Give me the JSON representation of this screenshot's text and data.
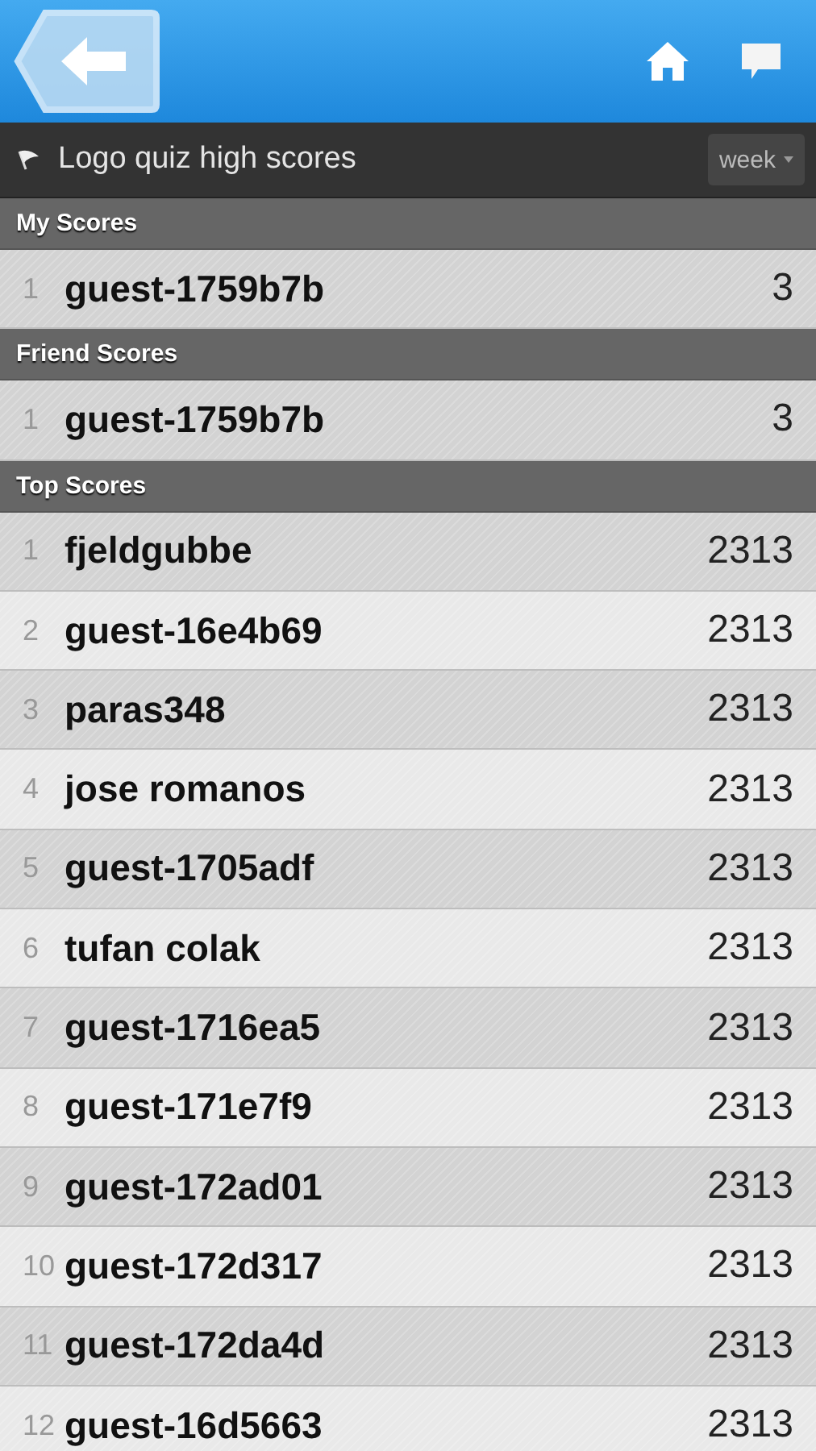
{
  "title_bar": {
    "title": "Logo quiz high scores",
    "period": "week"
  },
  "sections": [
    {
      "heading": "My Scores",
      "rows": [
        {
          "rank": "1",
          "name": "guest-1759b7b",
          "score": "3"
        }
      ]
    },
    {
      "heading": "Friend Scores",
      "rows": [
        {
          "rank": "1",
          "name": "guest-1759b7b",
          "score": "3"
        }
      ]
    },
    {
      "heading": "Top Scores",
      "rows": [
        {
          "rank": "1",
          "name": "fjeldgubbe",
          "score": "2313"
        },
        {
          "rank": "2",
          "name": "guest-16e4b69",
          "score": "2313"
        },
        {
          "rank": "3",
          "name": "paras348",
          "score": "2313"
        },
        {
          "rank": "4",
          "name": "jose romanos",
          "score": "2313"
        },
        {
          "rank": "5",
          "name": "guest-1705adf",
          "score": "2313"
        },
        {
          "rank": "6",
          "name": "tufan colak",
          "score": "2313"
        },
        {
          "rank": "7",
          "name": "guest-1716ea5",
          "score": "2313"
        },
        {
          "rank": "8",
          "name": "guest-171e7f9",
          "score": "2313"
        },
        {
          "rank": "9",
          "name": "guest-172ad01",
          "score": "2313"
        },
        {
          "rank": "10",
          "name": "guest-172d317",
          "score": "2313"
        },
        {
          "rank": "11",
          "name": "guest-172da4d",
          "score": "2313"
        },
        {
          "rank": "12",
          "name": "guest-16d5663",
          "score": "2313"
        }
      ]
    }
  ]
}
